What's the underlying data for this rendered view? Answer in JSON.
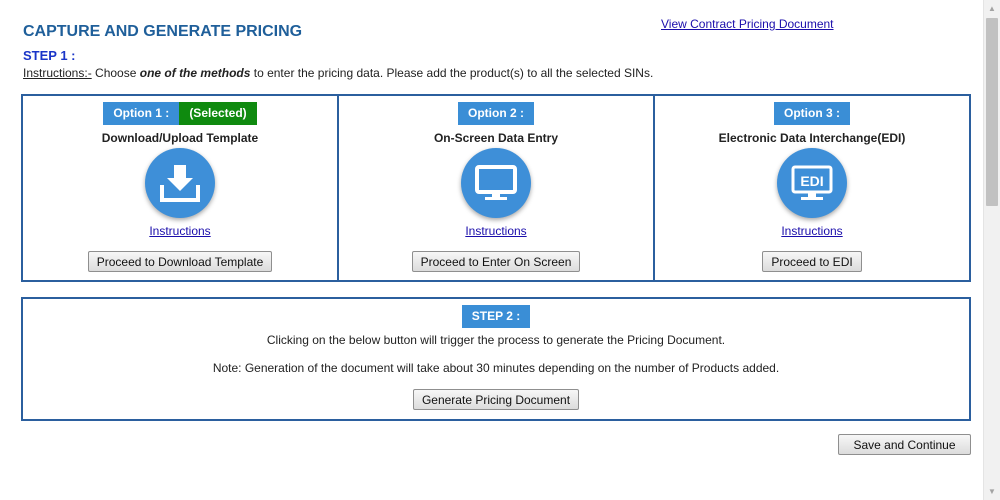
{
  "page": {
    "title": "CAPTURE AND GENERATE PRICING",
    "contract_link": "View Contract Pricing Document"
  },
  "step1": {
    "label": "STEP 1 :",
    "instructions_prefix": "Instructions:-",
    "instructions_text_a": " Choose ",
    "instructions_emphasis": "one of the methods",
    "instructions_text_b": " to enter the pricing data. Please add the product(s) to all the selected SINs."
  },
  "options": [
    {
      "badge": "Option 1 :",
      "selected_label": "(Selected)",
      "title": "Download/Upload Template",
      "icon": "download-icon",
      "instructions_link": "Instructions",
      "button": "Proceed to Download Template"
    },
    {
      "badge": "Option 2 :",
      "title": "On-Screen Data Entry",
      "icon": "monitor-icon",
      "instructions_link": "Instructions",
      "button": "Proceed to Enter On Screen"
    },
    {
      "badge": "Option 3 :",
      "title": "Electronic Data Interchange(EDI)",
      "icon": "edi-monitor-icon",
      "icon_text": "EDI",
      "instructions_link": "Instructions",
      "button": "Proceed to EDI"
    }
  ],
  "step2": {
    "label": "STEP 2 :",
    "text1": "Clicking on the below button will trigger the process to generate the Pricing Document.",
    "text2": "Note: Generation of the document will take about 30 minutes depending on the number of Products added.",
    "button": "Generate Pricing Document"
  },
  "footer": {
    "save_button": "Save and Continue"
  },
  "colors": {
    "title": "#1f5f9a",
    "step1": "#1a35c8",
    "badge": "#3a8ed6",
    "selected": "#0f8a0f",
    "border": "#2b5f9e",
    "icon_circle": "#3e8fd8",
    "link": "#1a0dab"
  }
}
